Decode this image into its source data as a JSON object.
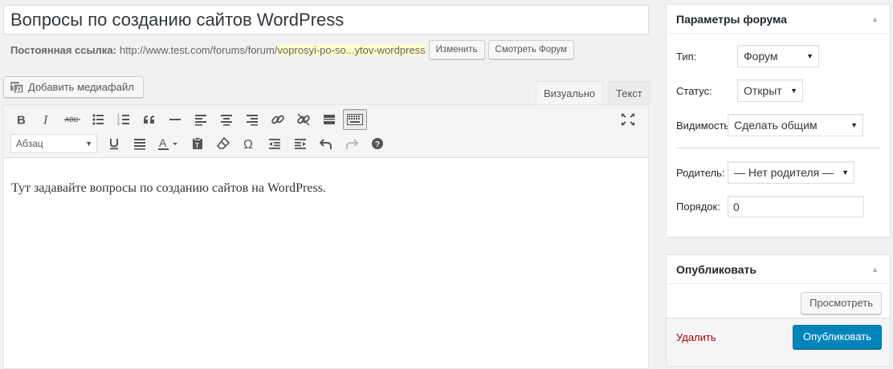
{
  "post": {
    "title": "Вопросы по созданию сайтов WordPress",
    "content": "Тут задавайте вопросы по созданию сайтов на WordPress."
  },
  "permalink": {
    "label": "Постоянная ссылка:",
    "base": "http://www.test.com/forums/forum/",
    "slug": "voprosyi-po-so...ytov-wordpress",
    "edit_label": "Изменить",
    "view_label": "Смотреть Форум"
  },
  "media": {
    "add_label": "Добавить медиафайл"
  },
  "editor": {
    "tabs": {
      "visual": "Визуально",
      "text": "Текст"
    },
    "format_select": "Абзац",
    "toolbar_row1": [
      "bold",
      "italic",
      "strikethrough",
      "bullet-list",
      "numbered-list",
      "blockquote",
      "horizontal-rule",
      "align-left",
      "align-center",
      "align-right",
      "insert-link",
      "remove-link",
      "read-more",
      "toolbar-toggle"
    ],
    "toolbar_row2": [
      "underline",
      "justify",
      "text-color",
      "paste-as-text",
      "clear-formatting",
      "special-character",
      "outdent",
      "indent",
      "undo",
      "redo",
      "help"
    ]
  },
  "forum_attributes": {
    "title": "Параметры форума",
    "type_label": "Тип:",
    "type_value": "Форум",
    "status_label": "Статус:",
    "status_value": "Открыт",
    "visibility_label": "Видимость:",
    "visibility_value": "Сделать общим",
    "parent_label": "Родитель:",
    "parent_value": "— Нет родителя —",
    "order_label": "Порядок:",
    "order_value": "0"
  },
  "publish": {
    "title": "Опубликовать",
    "preview_label": "Просмотреть",
    "delete_label": "Удалить",
    "publish_label": "Опубликовать"
  },
  "colors": {
    "primary": "#0085ba",
    "delete": "#aa0000",
    "slug_highlight": "#fffbcc"
  }
}
